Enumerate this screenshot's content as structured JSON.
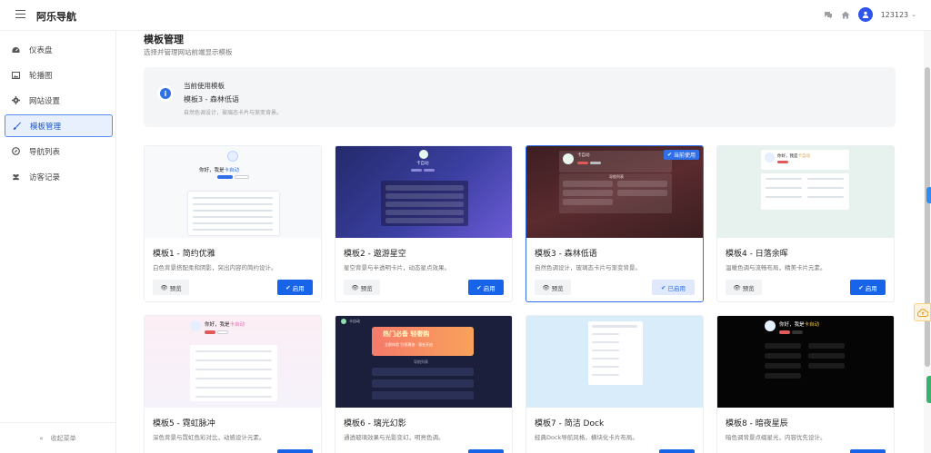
{
  "app": {
    "title": "阿乐导航"
  },
  "header": {
    "username": "123123"
  },
  "sidebar": {
    "items": [
      {
        "label": "仪表盘",
        "icon": "dashboard-icon"
      },
      {
        "label": "轮播图",
        "icon": "image-icon"
      },
      {
        "label": "网站设置",
        "icon": "gear-icon"
      },
      {
        "label": "模板管理",
        "icon": "brush-icon",
        "active": true
      },
      {
        "label": "导航列表",
        "icon": "compass-icon"
      },
      {
        "label": "访客记录",
        "icon": "users-icon"
      }
    ],
    "collapse_label": "收起菜单"
  },
  "page": {
    "title": "模板管理",
    "subtitle": "选择并管理网站前端显示模板"
  },
  "banner": {
    "heading": "当前使用模板",
    "current": "模板3 - 森林低语",
    "desc": "自然色调设计，玻璃态卡片与渐变背景。"
  },
  "buttons": {
    "preview": "预览",
    "apply": "启用",
    "in_use": "已启用",
    "current_badge": "当前使用"
  },
  "thumb_text": {
    "hello": "你好，我是",
    "hello_short": "你好，我是",
    "name": "卡自动",
    "brand_small": "卡自动",
    "section": "导航列表",
    "promo1": "热门必备 轻奢购",
    "promo2": "立即体验 引领潮流 · 现在开启",
    "dark_section": "导航列表"
  },
  "templates": [
    {
      "name": "模板1 - 简约优雅",
      "desc": "白色背景搭配柔和阴影，突出内容的简约设计。",
      "selected": false
    },
    {
      "name": "模板2 - 遨游星空",
      "desc": "星空背景与半透明卡片，动态星点效果。",
      "selected": false
    },
    {
      "name": "模板3 - 森林低语",
      "desc": "自然色调设计，玻璃态卡片与渐变背景。",
      "selected": true
    },
    {
      "name": "模板4 - 日落余晖",
      "desc": "温暖色调与流畅布局，精美卡片元素。",
      "selected": false
    },
    {
      "name": "模板5 - 霓虹脉冲",
      "desc": "深色背景与霓虹色彩对比，动感设计元素。",
      "selected": false
    },
    {
      "name": "模板6 - 璃光幻影",
      "desc": "通透玻璃效果与光影变幻，明亮色调。",
      "selected": false
    },
    {
      "name": "模板7 - 简洁 Dock",
      "desc": "经典Dock导航风格，横块化卡片布局。",
      "selected": false
    },
    {
      "name": "模板8 - 暗夜星辰",
      "desc": "暗色调背景点缀星光，内容优先设计。",
      "selected": false
    }
  ],
  "colors": {
    "accent": "#1764e8",
    "selected_border": "#2f6fe8"
  }
}
